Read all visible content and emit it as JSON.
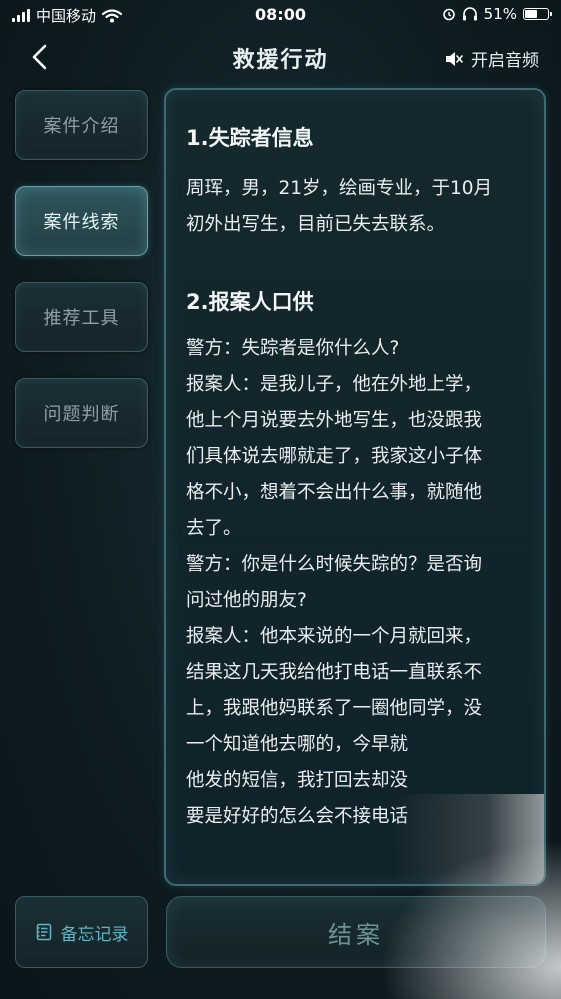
{
  "status_bar": {
    "carrier": "中国移动",
    "time": "08:00",
    "battery": "51%",
    "icons": [
      "signal-icon",
      "wifi-icon",
      "alarm-icon",
      "headphones-icon",
      "battery-icon"
    ]
  },
  "nav": {
    "title": "救援行动",
    "audio_label": "开启音频",
    "icons": [
      "back-chevron-icon",
      "speaker-muted-icon"
    ]
  },
  "sidebar": {
    "items": [
      {
        "label": "案件介绍",
        "active": false
      },
      {
        "label": "案件线索",
        "active": true
      },
      {
        "label": "推荐工具",
        "active": false
      },
      {
        "label": "问题判断",
        "active": false
      }
    ]
  },
  "content": {
    "section1": {
      "title": "1.失踪者信息",
      "lines": [
        "周珲，男，21岁，绘画专业，于10月",
        "初外出写生，目前已失去联系。"
      ]
    },
    "section2": {
      "title": "2.报案人口供",
      "lines": [
        "警方：失踪者是你什么人?",
        "报案人：是我儿子，他在外地上学，",
        "他上个月说要去外地写生，也没跟我",
        "们具体说去哪就走了，我家这小子体",
        "格不小，想着不会出什么事，就随他",
        "去了。",
        "警方：你是什么时候失踪的？是否询",
        "问过他的朋友?",
        "报案人：他本来说的一个月就回来，",
        "结果这几天我给他打电话一直联系不",
        "上，我跟他妈联系了一圈他同学，没",
        "一个知道他去哪的，今早就",
        "他发的短信，我打回去却没",
        "要是好好的怎么会不接电话"
      ]
    }
  },
  "bottom": {
    "memo_label": "备忘记录",
    "close_label": "结案",
    "memo_icon": "notebook-icon"
  },
  "colors": {
    "background": "#0e1d22",
    "panel_border": "#3f6a71",
    "active_tab": "#2f555c",
    "memo_accent": "#5fb6c0"
  }
}
